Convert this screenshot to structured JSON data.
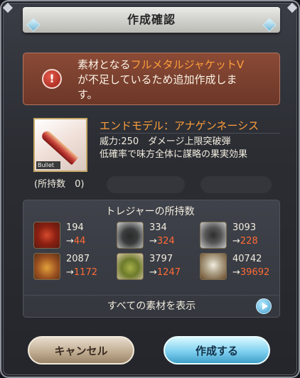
{
  "dialog": {
    "title": "作成確認",
    "alert": {
      "line1_prefix": "素材となる",
      "line1_highlight": "フルメタルジャケットV",
      "line2": "が不足しているため追加作成しま",
      "line3": "す。"
    },
    "item": {
      "tag": "Bullet",
      "owned": "(所持数　0)",
      "name": "エンドモデル：アナゲンネーシス",
      "stats_line1": "威力:250　ダメージ上限突破弾",
      "stats_line2": "低確率で味方全体に謀略の果実効果"
    },
    "treasures": {
      "heading": "トレジャーの所持数",
      "items": [
        {
          "have": "194",
          "arrow": "→",
          "after": "44"
        },
        {
          "have": "334",
          "arrow": "→",
          "after": "324"
        },
        {
          "have": "3093",
          "arrow": "→",
          "after": "228"
        },
        {
          "have": "2087",
          "arrow": "→",
          "after": "1172"
        },
        {
          "have": "3797",
          "arrow": "→",
          "after": "1247"
        },
        {
          "have": "40742",
          "arrow": "→",
          "after": "39692"
        }
      ]
    },
    "show_all_label": "すべての素材を表示",
    "buttons": {
      "cancel": "キャンセル",
      "create": "作成する"
    }
  },
  "colors": {
    "highlight": "#ff9f3a",
    "after_value": "#ff6a36",
    "accent_blue": "#7fd0f0"
  }
}
